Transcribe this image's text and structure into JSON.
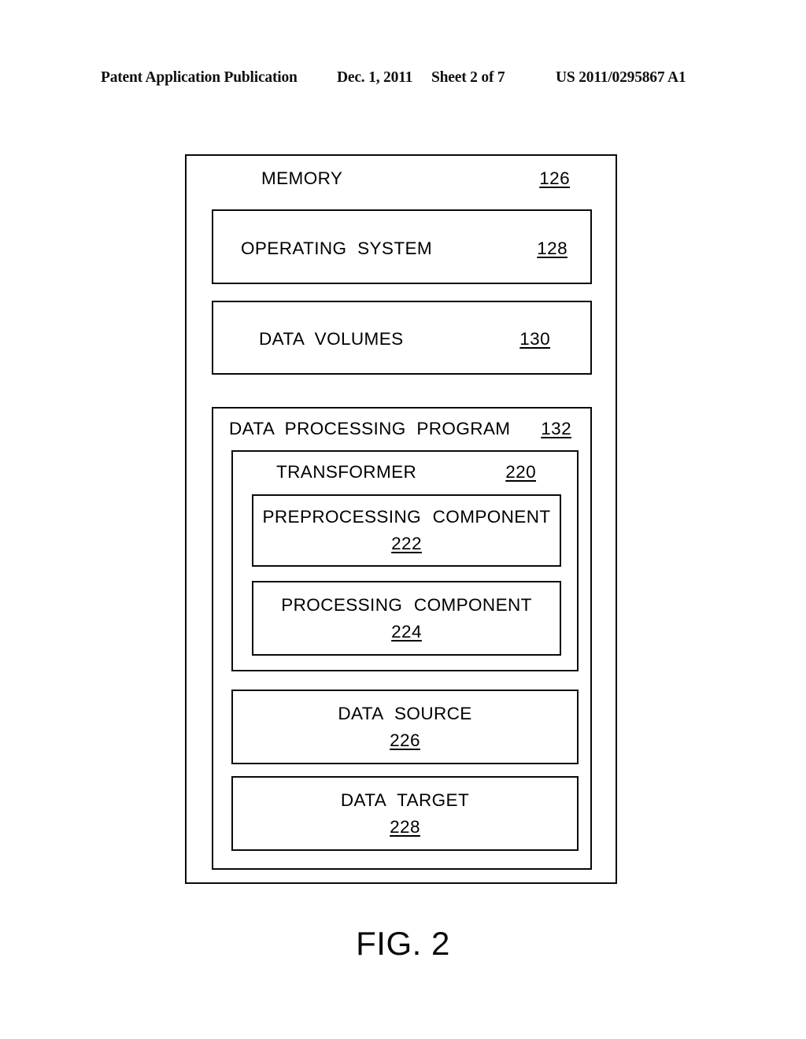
{
  "header": {
    "publication": "Patent Application Publication",
    "date": "Dec. 1, 2011",
    "sheet": "Sheet 2 of 7",
    "patent_number": "US 2011/0295867 A1"
  },
  "figure": {
    "caption": "FIG. 2"
  },
  "diagram": {
    "memory": {
      "label": "MEMORY",
      "ref": "126"
    },
    "operating_system": {
      "label": "OPERATING  SYSTEM",
      "ref": "128"
    },
    "data_volumes": {
      "label": "DATA  VOLUMES",
      "ref": "130"
    },
    "data_processing_program": {
      "label": "DATA  PROCESSING PROGRAM",
      "ref": "132"
    },
    "transformer": {
      "label": "TRANSFORMER",
      "ref": "220"
    },
    "preprocessing_component": {
      "label": "PREPROCESSING  COMPONENT",
      "ref": "222"
    },
    "processing_component": {
      "label": "PROCESSING  COMPONENT",
      "ref": "224"
    },
    "data_source": {
      "label": "DATA  SOURCE",
      "ref": "226"
    },
    "data_target": {
      "label": "DATA  TARGET",
      "ref": "228"
    }
  }
}
